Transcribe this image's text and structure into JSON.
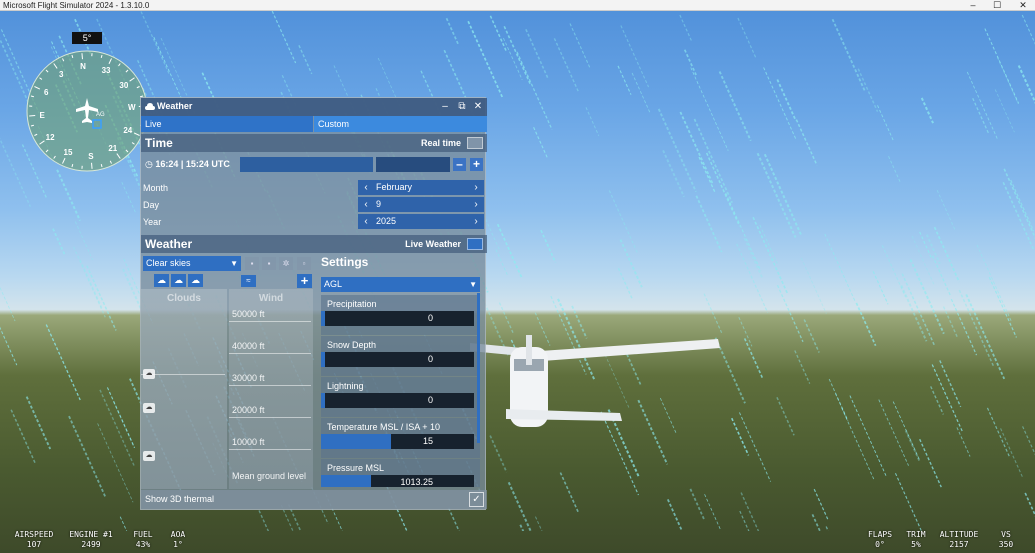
{
  "window": {
    "title": "Microsoft Flight Simulator 2024 - 1.3.10.0",
    "min_glyph": "–",
    "max_glyph": "☐",
    "close_glyph": "✕"
  },
  "compass": {
    "heading_readout": "5°",
    "marks": [
      "N",
      "33",
      "30",
      "W",
      "24",
      "21",
      "S",
      "15",
      "12",
      "E",
      "6",
      "3"
    ],
    "beacon_label": "AG"
  },
  "weather_panel": {
    "title": "Weather",
    "minimize_glyph": "–",
    "popout_glyph": "⧉",
    "close_glyph": "✕",
    "modes": {
      "live": "Live",
      "custom": "Custom"
    },
    "time": {
      "title": "Time",
      "realtime_label": "Real time",
      "clock": "16:24 | 15:24 UTC",
      "minus": "–",
      "plus": "+",
      "fields": [
        {
          "label": "Month",
          "value": "February"
        },
        {
          "label": "Day",
          "value": "9"
        },
        {
          "label": "Year",
          "value": "2025"
        }
      ],
      "prev_glyph": "‹",
      "next_glyph": "›"
    },
    "weather": {
      "title": "Weather",
      "live_weather_label": "Live Weather",
      "preset": "Clear skies",
      "clouds_header": "Clouds",
      "wind_header": "Wind",
      "altitudes": [
        "50000 ft",
        "40000 ft",
        "30000 ft",
        "20000 ft",
        "10000 ft",
        "Mean ground level"
      ],
      "add_glyph": "+"
    },
    "settings": {
      "title": "Settings",
      "reference": "AGL",
      "items": [
        {
          "label": "Precipitation",
          "value": "0",
          "fill": 0.02
        },
        {
          "label": "Snow Depth",
          "value": "0",
          "fill": 0.02
        },
        {
          "label": "Lightning",
          "value": "0",
          "fill": 0.02
        },
        {
          "label": "Temperature MSL / ISA + 10",
          "value": "15",
          "fill": 0.46
        },
        {
          "label": "Pressure MSL",
          "value": "1013.25",
          "fill": 0.33
        }
      ]
    },
    "thermal_label": "Show 3D thermal",
    "check_glyph": "✓"
  },
  "hud": [
    {
      "label": "AIRSPEED",
      "value": "107"
    },
    {
      "label": "ENGINE #1",
      "value": "2499"
    },
    {
      "label": "FUEL",
      "value": "43%"
    },
    {
      "label": "AOA",
      "value": "1°"
    },
    {
      "label": "FLAPS",
      "value": "0°"
    },
    {
      "label": "TRIM",
      "value": "5%"
    },
    {
      "label": "ALTITUDE",
      "value": "2157"
    },
    {
      "label": "VS",
      "value": "350"
    }
  ]
}
